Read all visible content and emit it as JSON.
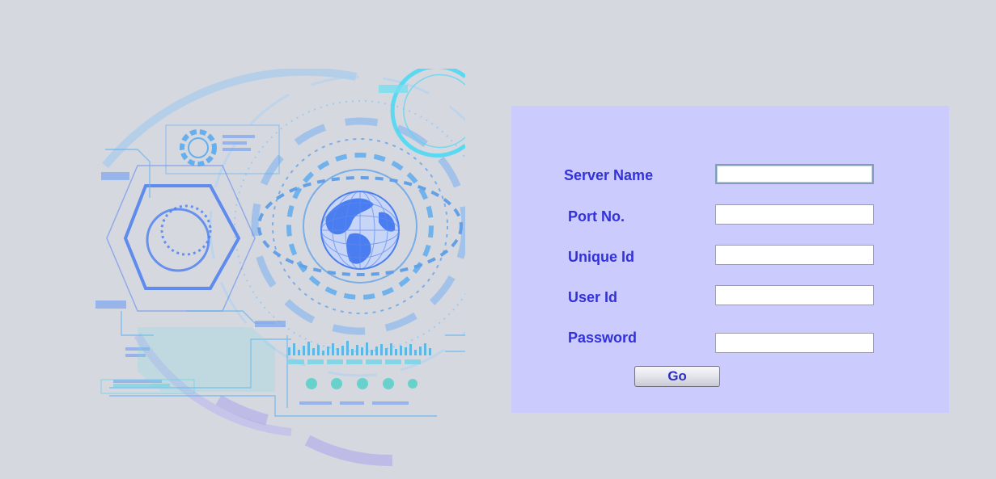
{
  "login_form": {
    "fields": [
      {
        "label": "Server Name",
        "value": ""
      },
      {
        "label": "Port No.",
        "value": ""
      },
      {
        "label": "Unique Id",
        "value": ""
      },
      {
        "label": "User Id",
        "value": ""
      },
      {
        "label": "Password",
        "value": ""
      }
    ],
    "go_label": "Go"
  },
  "colors": {
    "page_background": "#d6d8e0",
    "panel_background": "#cbcbfd",
    "label_text": "#3232d8",
    "illustration_primary": "#4a7ef0",
    "illustration_accent": "#4fd8e8"
  },
  "illustration": {
    "icon": "globe-tech-icon"
  }
}
